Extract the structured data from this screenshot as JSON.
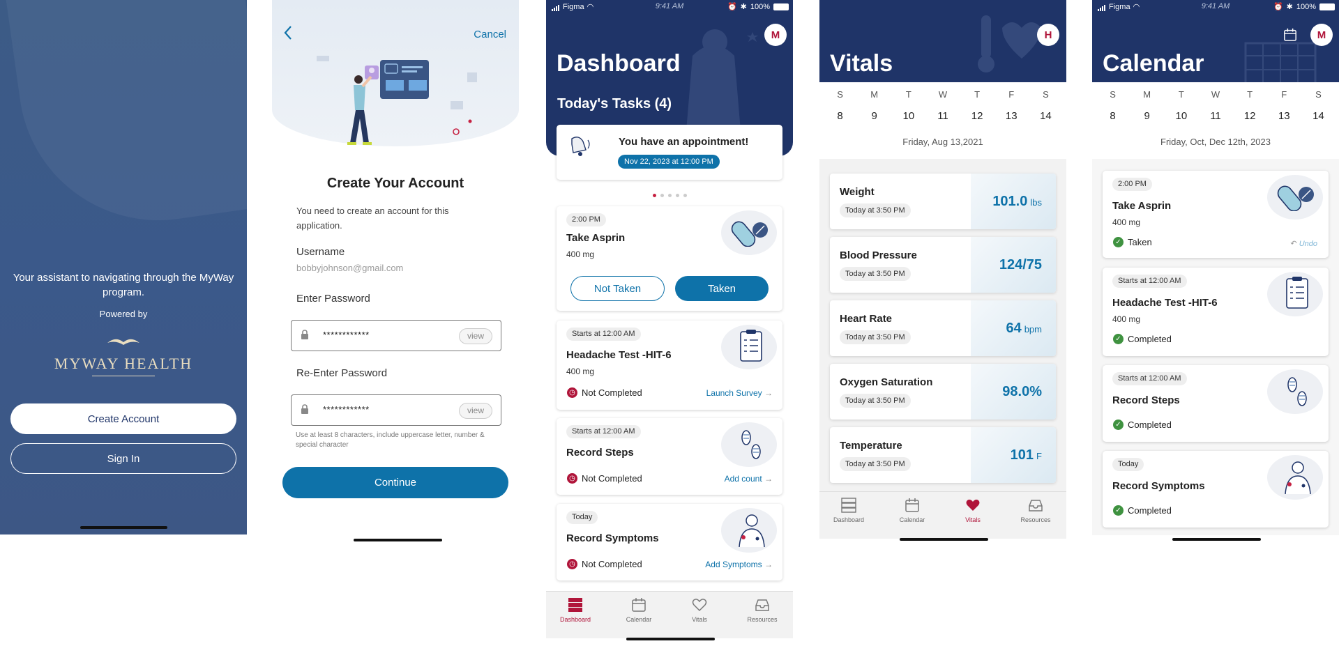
{
  "welcome": {
    "tagline": "Your assistant to navigating through the MyWay program.",
    "powered_by": "Powered by",
    "logo": "MYWAY HEALTH",
    "create_account": "Create Account",
    "sign_in": "Sign In"
  },
  "signup": {
    "cancel": "Cancel",
    "title": "Create Your Account",
    "intro": "You need to create an account for this application.",
    "username_label": "Username",
    "username_value": "bobbyjohnson@gmail.com",
    "password_label": "Enter Password",
    "password_value": "************",
    "reenter_label": "Re-Enter Password",
    "reenter_value": "************",
    "view": "view",
    "hint": "Use at least 8 characters, include uppercase letter, number & special character",
    "continue": "Continue"
  },
  "status": {
    "carrier": "Figma",
    "time": "9:41 AM",
    "battery": "100%"
  },
  "dashboard": {
    "avatar": "M",
    "title": "Dashboard",
    "tasks_title": "Today's Tasks (4)",
    "appointment_title": "You have an appointment!",
    "appointment_time": "Nov 22, 2023 at 12:00 PM",
    "tasks": [
      {
        "time": "2:00 PM",
        "title": "Take Asprin",
        "dose": "400 mg",
        "not_taken": "Not Taken",
        "taken": "Taken"
      },
      {
        "time": "Starts at 12:00 AM",
        "title": "Headache Test -HIT-6",
        "dose": "400 mg",
        "status": "Not Completed",
        "action": "Launch Survey"
      },
      {
        "time": "Starts at 12:00 AM",
        "title": "Record Steps",
        "status": "Not Completed",
        "action": "Add count"
      },
      {
        "time": "Today",
        "title": "Record Symptoms",
        "status": "Not Completed",
        "action": "Add Symptoms"
      }
    ]
  },
  "tabs": {
    "dashboard": "Dashboard",
    "calendar": "Calendar",
    "vitals": "Vitals",
    "resources": "Resources"
  },
  "vitals": {
    "avatar": "H",
    "title": "Vitals",
    "days": [
      "S",
      "M",
      "T",
      "W",
      "T",
      "F",
      "S"
    ],
    "dates": [
      "8",
      "9",
      "10",
      "11",
      "12",
      "13",
      "14"
    ],
    "date_line": "Friday, Aug 13,2021",
    "items": [
      {
        "name": "Weight",
        "time": "Today at 3:50 PM",
        "value": "101.0",
        "unit": "lbs"
      },
      {
        "name": "Blood Pressure",
        "time": "Today at 3:50 PM",
        "value": "124/75",
        "unit": ""
      },
      {
        "name": "Heart Rate",
        "time": "Today at 3:50 PM",
        "value": "64",
        "unit": "bpm"
      },
      {
        "name": "Oxygen Saturation",
        "time": "Today at 3:50 PM",
        "value": "98.0%",
        "unit": ""
      },
      {
        "name": "Temperature",
        "time": "Today at 3:50 PM",
        "value": "101",
        "unit": "F"
      }
    ]
  },
  "calendar": {
    "avatar": "M",
    "title": "Calendar",
    "days": [
      "S",
      "M",
      "T",
      "W",
      "T",
      "F",
      "S"
    ],
    "dates": [
      "8",
      "9",
      "10",
      "11",
      "12",
      "13",
      "14"
    ],
    "date_line": "Friday, Oct,  Dec 12th, 2023",
    "undo": "Undo",
    "tasks": [
      {
        "time": "2:00 PM",
        "title": "Take Asprin",
        "dose": "400 mg",
        "status": "Taken"
      },
      {
        "time": "Starts at 12:00 AM",
        "title": "Headache Test -HIT-6",
        "dose": "400 mg",
        "status": "Completed"
      },
      {
        "time": "Starts at 12:00 AM",
        "title": "Record Steps",
        "status": "Completed"
      },
      {
        "time": "Today",
        "title": "Record Symptoms",
        "status": "Completed"
      }
    ]
  },
  "colors": {
    "navy": "#1f3468",
    "accent": "#0e72a9",
    "alert": "#b0153a",
    "success": "#3f9240"
  }
}
